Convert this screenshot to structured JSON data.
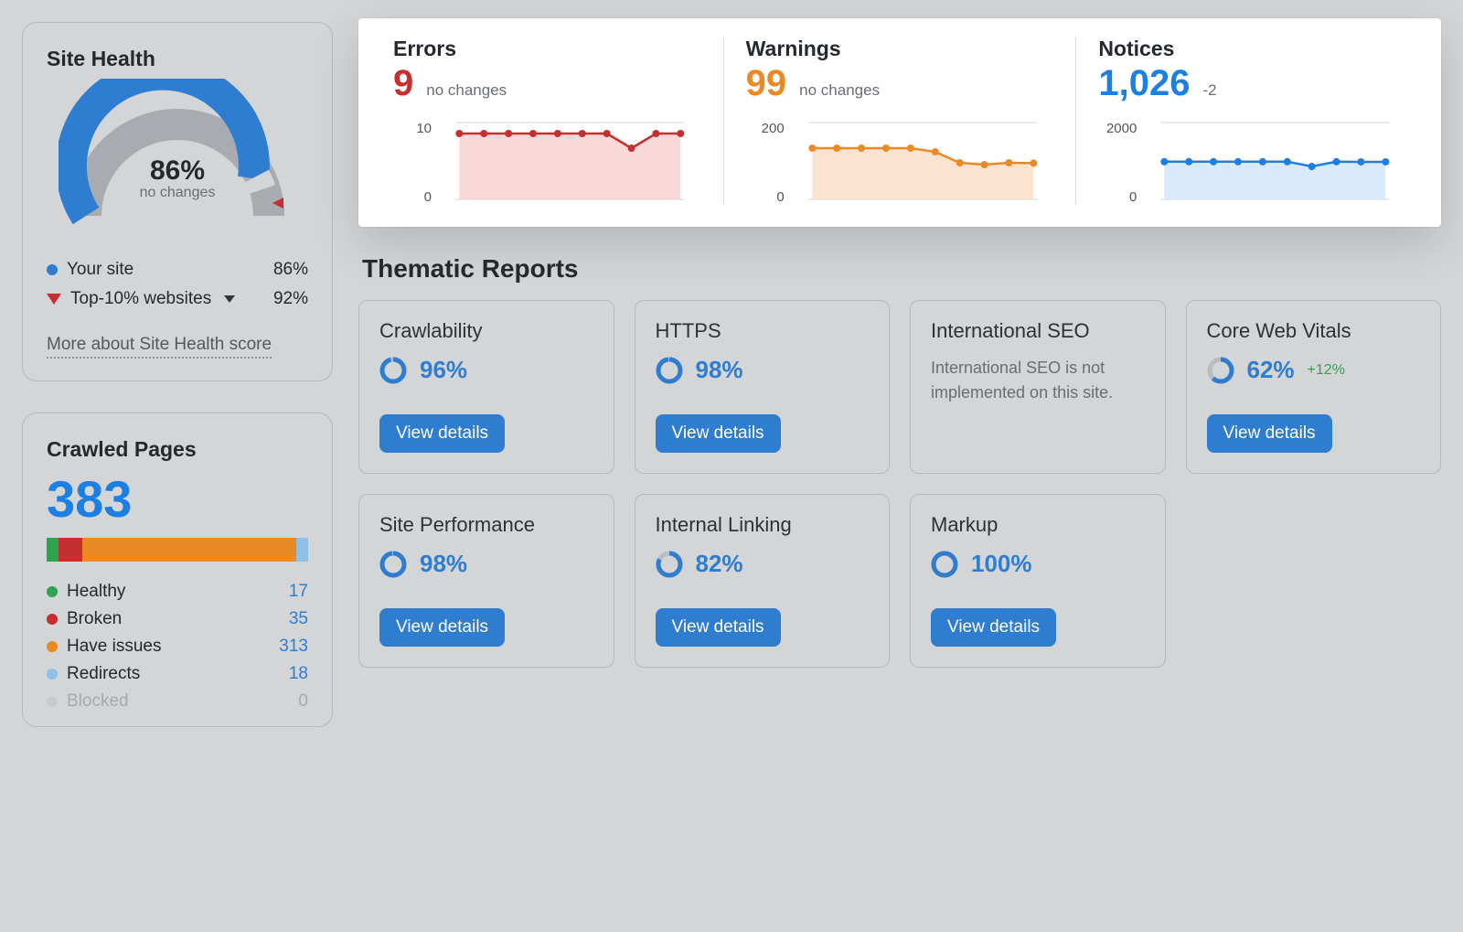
{
  "siteHealth": {
    "title": "Site Health",
    "percent": "86%",
    "sub": "no changes",
    "legend": {
      "yourSite": {
        "label": "Your site",
        "value": "86%",
        "color": "#2f7dd1"
      },
      "top10": {
        "label": "Top-10% websites",
        "value": "92%",
        "color": "#c52f2f"
      }
    },
    "moreLink": "More about Site Health score"
  },
  "crawledPages": {
    "title": "Crawled Pages",
    "total": "383",
    "rows": [
      {
        "label": "Healthy",
        "value": "17",
        "color": "#2ea44f"
      },
      {
        "label": "Broken",
        "value": "35",
        "color": "#c52f2f"
      },
      {
        "label": "Have issues",
        "value": "313",
        "color": "#ea8a26"
      },
      {
        "label": "Redirects",
        "value": "18",
        "color": "#8fc0ea"
      },
      {
        "label": "Blocked",
        "value": "0",
        "color": "#c7cbd0",
        "fade": true
      }
    ]
  },
  "issues": {
    "errors": {
      "title": "Errors",
      "value": "9",
      "sub": "no changes",
      "color": "#c52f2f",
      "yTop": "10",
      "yBot": "0"
    },
    "warnings": {
      "title": "Warnings",
      "value": "99",
      "sub": "no changes",
      "color": "#ea8a26",
      "yTop": "200",
      "yBot": "0"
    },
    "notices": {
      "title": "Notices",
      "value": "1,026",
      "sub": "-2",
      "color": "#1c80e3",
      "yTop": "2000",
      "yBot": "0"
    }
  },
  "thematic": {
    "title": "Thematic Reports",
    "viewDetails": "View details",
    "reports": [
      {
        "title": "Crawlability",
        "percent": "96%",
        "fill": 96
      },
      {
        "title": "HTTPS",
        "percent": "98%",
        "fill": 98
      },
      {
        "title": "International SEO",
        "note": "International SEO is not implemented on this site."
      },
      {
        "title": "Core Web Vitals",
        "percent": "62%",
        "delta": "+12%",
        "fill": 62
      },
      {
        "title": "Site Performance",
        "percent": "98%",
        "fill": 98
      },
      {
        "title": "Internal Linking",
        "percent": "82%",
        "fill": 82
      },
      {
        "title": "Markup",
        "percent": "100%",
        "fill": 100
      }
    ]
  },
  "chart_data": [
    {
      "type": "line",
      "name": "Errors",
      "ylim": [
        0,
        10
      ],
      "x": [
        1,
        2,
        3,
        4,
        5,
        6,
        7,
        8,
        9,
        10
      ],
      "values": [
        9,
        9,
        9,
        9,
        9,
        9,
        9,
        7,
        9,
        9
      ]
    },
    {
      "type": "line",
      "name": "Warnings",
      "ylim": [
        0,
        200
      ],
      "x": [
        1,
        2,
        3,
        4,
        5,
        6,
        7,
        8,
        9,
        10
      ],
      "values": [
        140,
        140,
        140,
        140,
        140,
        130,
        100,
        95,
        100,
        99
      ]
    },
    {
      "type": "line",
      "name": "Notices",
      "ylim": [
        0,
        2000
      ],
      "x": [
        1,
        2,
        3,
        4,
        5,
        6,
        7,
        8,
        9,
        10
      ],
      "values": [
        1030,
        1030,
        1030,
        1030,
        1030,
        1030,
        900,
        1030,
        1026,
        1026
      ]
    },
    {
      "type": "gauge",
      "name": "Site Health",
      "value": 86,
      "min": 0,
      "max": 100,
      "baseline": 92
    },
    {
      "type": "bar",
      "name": "Crawled Pages",
      "categories": [
        "Healthy",
        "Broken",
        "Have issues",
        "Redirects",
        "Blocked"
      ],
      "values": [
        17,
        35,
        313,
        18,
        0
      ]
    }
  ]
}
